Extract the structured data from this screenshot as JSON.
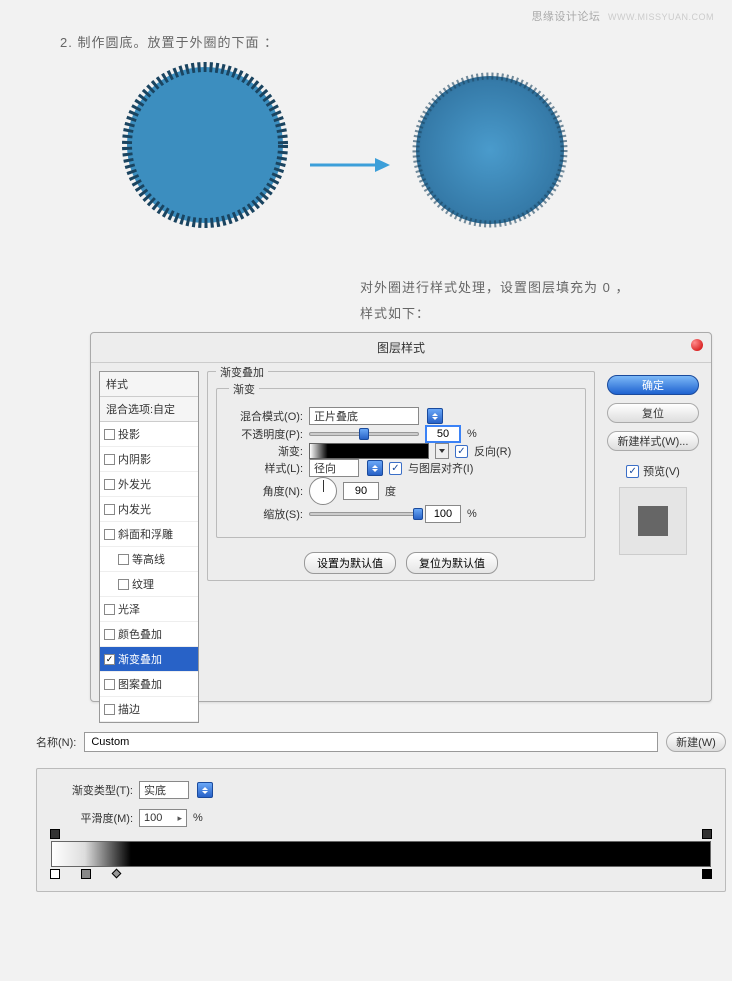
{
  "watermark": {
    "text": "思缘设计论坛",
    "url": "WWW.MISSYUAN.COM"
  },
  "instruction": "2. 制作圆底。放置于外圈的下面 ：",
  "sub_instruction_1": "对外圈进行样式处理，设置图层填充为 0 ，",
  "sub_instruction_2": "样式如下：",
  "dialog": {
    "title": "图层样式",
    "styles_header": "样式",
    "blend_options": "混合选项:自定",
    "items": [
      {
        "label": "投影",
        "checked": false
      },
      {
        "label": "内阴影",
        "checked": false
      },
      {
        "label": "外发光",
        "checked": false
      },
      {
        "label": "内发光",
        "checked": false
      },
      {
        "label": "斜面和浮雕",
        "checked": false
      },
      {
        "label": "等高线",
        "checked": false,
        "indented": true
      },
      {
        "label": "纹理",
        "checked": false,
        "indented": true
      },
      {
        "label": "光泽",
        "checked": false
      },
      {
        "label": "颜色叠加",
        "checked": false
      },
      {
        "label": "渐变叠加",
        "checked": true,
        "selected": true
      },
      {
        "label": "图案叠加",
        "checked": false
      },
      {
        "label": "描边",
        "checked": false
      }
    ],
    "group_title": "渐变叠加",
    "inner_title": "渐变",
    "blend_mode": {
      "label": "混合模式(O):",
      "value": "正片叠底"
    },
    "opacity": {
      "label": "不透明度(P):",
      "value": "50",
      "suffix": "%"
    },
    "gradient": {
      "label": "渐变:",
      "reverse_label": "反向(R)",
      "reverse_checked": true
    },
    "style": {
      "label": "样式(L):",
      "value": "径向",
      "align_label": "与图层对齐(I)",
      "align_checked": true
    },
    "angle": {
      "label": "角度(N):",
      "value": "90",
      "suffix": "度"
    },
    "scale": {
      "label": "缩放(S):",
      "value": "100",
      "suffix": "%"
    },
    "btn_default": "设置为默认值",
    "btn_reset": "复位为默认值",
    "btn_ok": "确定",
    "btn_cancel": "复位",
    "btn_newstyle": "新建样式(W)...",
    "preview_label": "预览(V)",
    "preview_checked": true
  },
  "gradient_editor": {
    "name_label": "名称(N):",
    "name_value": "Custom",
    "btn_new": "新建(W)",
    "type_label": "渐变类型(T):",
    "type_value": "实底",
    "smooth_label": "平滑度(M):",
    "smooth_value": "100",
    "smooth_suffix": "%"
  }
}
